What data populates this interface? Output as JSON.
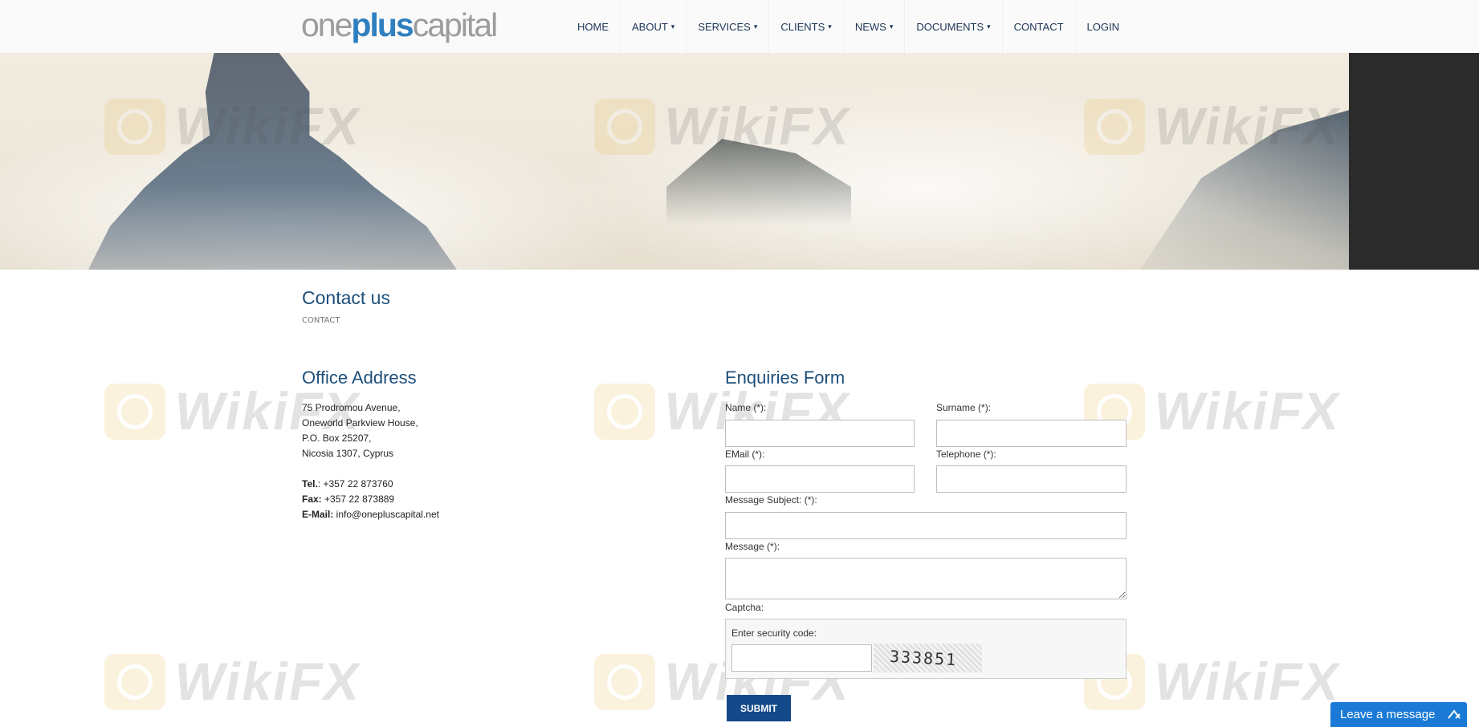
{
  "logo": {
    "part1": "one",
    "part2": "plus",
    "part3": "capital"
  },
  "nav": {
    "items": [
      {
        "label": "HOME",
        "has_caret": false
      },
      {
        "label": "ABOUT",
        "has_caret": true
      },
      {
        "label": "SERVICES",
        "has_caret": true
      },
      {
        "label": "CLIENTS",
        "has_caret": true
      },
      {
        "label": "NEWS",
        "has_caret": true
      },
      {
        "label": "DOCUMENTS",
        "has_caret": true
      },
      {
        "label": "CONTACT",
        "has_caret": false
      },
      {
        "label": "LOGIN",
        "has_caret": false
      }
    ]
  },
  "watermark": {
    "text": "WikiFX"
  },
  "page": {
    "title": "Contact us",
    "breadcrumb": "CONTACT"
  },
  "office": {
    "title": "Office Address",
    "line1": "75 Prodromou Avenue,",
    "line2": "Oneworld Parkview House,",
    "line3": "P.O. Box 25207,",
    "line4": "Nicosia 1307, Cyprus",
    "tel_label": "Tel.",
    "tel": ": +357 22 873760",
    "fax_label": "Fax:",
    "fax": " +357 22 873889",
    "email_label": "E-Mail:",
    "email": " info@onepluscapital.net"
  },
  "form": {
    "title": "Enquiries Form",
    "name_label": "Name (*):",
    "surname_label": "Surname (*):",
    "email_label": "EMail (*):",
    "telephone_label": "Telephone (*):",
    "subject_label": "Message Subject: (*):",
    "message_label": "Message (*):",
    "captcha_label": "Captcha:",
    "security_label": "Enter security code:",
    "captcha_code": "333851",
    "submit_label": "SUBMIT",
    "name_value": "",
    "surname_value": "",
    "email_value": "",
    "telephone_value": "",
    "subject_value": "",
    "message_value": "",
    "security_value": ""
  },
  "chat": {
    "label": "Leave a message",
    "icon": "chevron-up-icon"
  },
  "colors": {
    "brand_blue": "#1d4f7a",
    "logo_accent": "#2f7fbf",
    "submit_bg": "#154a8a",
    "chat_bg": "#1a7ad6"
  }
}
